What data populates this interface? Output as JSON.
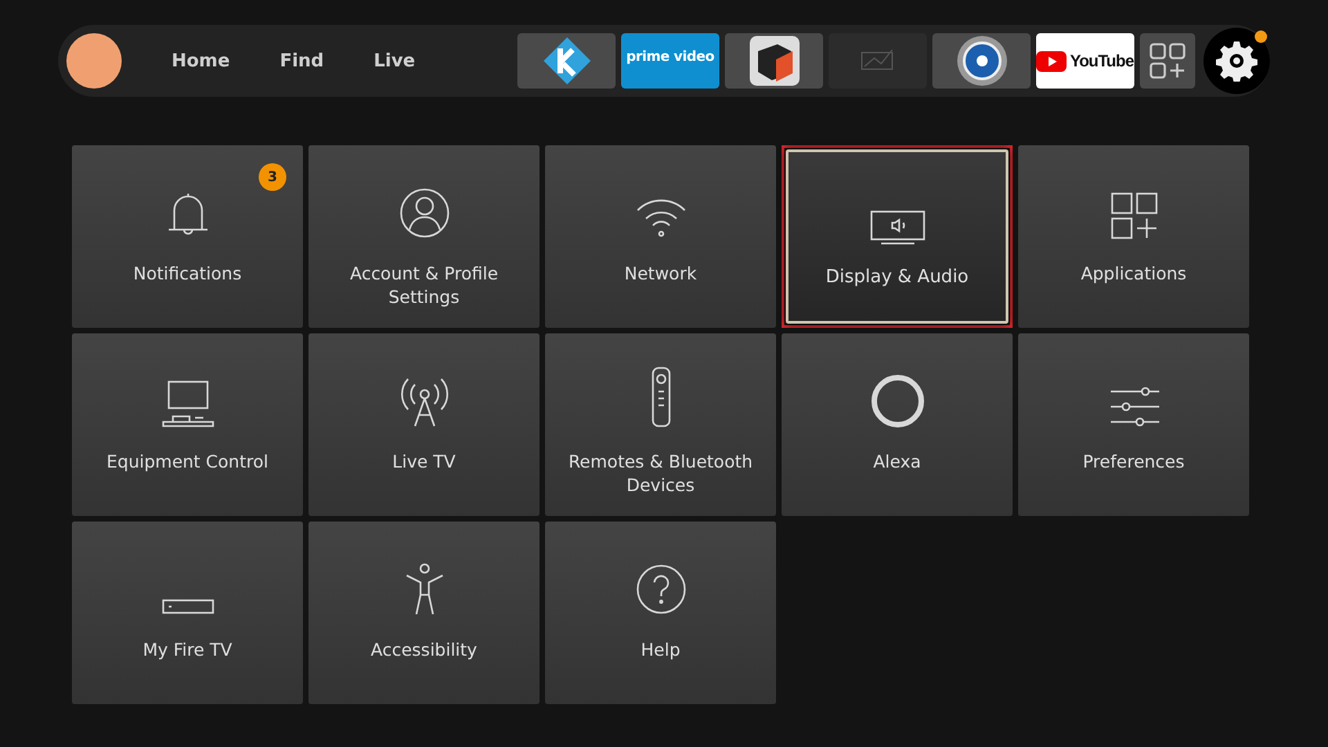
{
  "nav": {
    "tabs": [
      {
        "label": "Home",
        "selected": false
      },
      {
        "label": "Find",
        "selected": false
      },
      {
        "label": "Live",
        "selected": false
      }
    ]
  },
  "apps": [
    {
      "kind": "kodi"
    },
    {
      "kind": "prime",
      "label": "prime video"
    },
    {
      "kind": "cube"
    },
    {
      "kind": "faded"
    },
    {
      "kind": "orb"
    },
    {
      "kind": "youtube",
      "label": "YouTube"
    },
    {
      "kind": "grid"
    }
  ],
  "settings": {
    "selected": true,
    "notification_dot": true
  },
  "tiles": [
    {
      "label": "Notifications",
      "kind": "bell",
      "badge": "3",
      "selected": false
    },
    {
      "label": "Account & Profile Settings",
      "kind": "person",
      "selected": false
    },
    {
      "label": "Network",
      "kind": "wifi",
      "selected": false
    },
    {
      "label": "Display & Audio",
      "kind": "tv",
      "selected": true
    },
    {
      "label": "Applications",
      "kind": "apps",
      "selected": false
    },
    {
      "label": "Equipment Control",
      "kind": "computer",
      "selected": false
    },
    {
      "label": "Live TV",
      "kind": "antenna",
      "selected": false
    },
    {
      "label": "Remotes & Bluetooth Devices",
      "kind": "remote",
      "selected": false
    },
    {
      "label": "Alexa",
      "kind": "ring",
      "selected": false
    },
    {
      "label": "Preferences",
      "kind": "sliders",
      "selected": false
    },
    {
      "label": "My Fire TV",
      "kind": "stick",
      "selected": false
    },
    {
      "label": "Accessibility",
      "kind": "figure",
      "selected": false
    },
    {
      "label": "Help",
      "kind": "help",
      "selected": false
    }
  ]
}
